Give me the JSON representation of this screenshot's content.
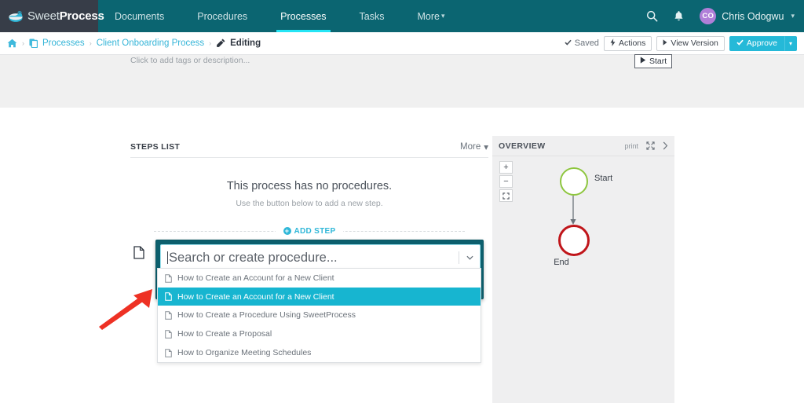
{
  "nav": {
    "logo": {
      "text_light": "Sweet",
      "text_bold": "Process",
      "icon": "sweetprocess-logo-icon"
    },
    "items": [
      {
        "label": "Documents",
        "active": false
      },
      {
        "label": "Procedures",
        "active": false
      },
      {
        "label": "Processes",
        "active": true
      },
      {
        "label": "Tasks",
        "active": false
      },
      {
        "label": "More",
        "active": false,
        "caret": "⌄"
      }
    ],
    "search_icon": "search-icon",
    "bell_icon": "notification-bell-icon",
    "user": {
      "initials": "CO",
      "name": "Chris Odogwu",
      "caret": "⌄"
    },
    "bg_color": "#0b6571",
    "active_underline_color": "#25e5f5",
    "logo_bg_color": "#373d48"
  },
  "breadcrumb": {
    "home_icon": "home-icon",
    "sep": "›",
    "items": [
      {
        "label": "Processes",
        "icon": "copy-icon",
        "link": true
      },
      {
        "label": "Client Onboarding Process",
        "icon": null,
        "link": true
      },
      {
        "label": "Editing",
        "icon": "pencil-icon",
        "link": false
      }
    ],
    "actions": {
      "saved_label": "Saved",
      "saved_icon": "check-icon",
      "actions_label": "Actions",
      "actions_icon": "bolt-icon",
      "view_version_label": "View Version",
      "view_version_icon": "caret-right-icon",
      "approve_label": "Approve",
      "approve_icon": "check-icon",
      "approve_caret": "⌄",
      "approve_color": "#25b9d8"
    }
  },
  "header_band": {
    "tagline_placeholder": "Click to add tags or description...",
    "start_button": {
      "label": "Start",
      "icon": "play-icon"
    }
  },
  "steps_panel": {
    "title": "STEPS LIST",
    "more_label": "More",
    "more_caret": "⌄",
    "empty_title": "This process has no procedures.",
    "empty_subtitle": "Use the button below to add a new step.",
    "add_step_label": "ADD STEP",
    "add_step_icon": "plus-circle-icon",
    "add_step_color": "#2fb7d8"
  },
  "search_combo": {
    "row_icon": "document-icon",
    "placeholder": "Search or create procedure...",
    "value": "",
    "chevron_icon": "chevron-down-icon",
    "shell_color": "#0c5f6d",
    "focus_border_color": "#9fe4f0"
  },
  "dropdown": {
    "selected_index": 1,
    "highlight_color": "#17b5d0",
    "items": [
      {
        "label": "How to Create an Account for a New Client",
        "icon": "document-icon"
      },
      {
        "label": "How to Create an Account for a New Client",
        "icon": "document-icon"
      },
      {
        "label": "How to Create a Procedure Using SweetProcess",
        "icon": "document-icon"
      },
      {
        "label": "How to Create a Proposal",
        "icon": "document-icon"
      },
      {
        "label": "How to Organize Meeting Schedules",
        "icon": "document-icon"
      }
    ]
  },
  "annotation": {
    "arrow_icon": "red-pointer-arrow-icon",
    "color": "#ee3124"
  },
  "overview": {
    "title": "OVERVIEW",
    "print_label": "print",
    "expand_icon": "expand-arrows-icon",
    "next_icon": "chevron-right-icon",
    "zoom_in_label": "+",
    "zoom_out_label": "−",
    "fit_icon": "fit-screen-icon",
    "nodes": [
      {
        "label": "Start",
        "color": "#8ec63f",
        "shape": "circle"
      },
      {
        "label": "End",
        "color": "#c0151a",
        "shape": "circle"
      }
    ],
    "bg_color": "#efeff0"
  }
}
